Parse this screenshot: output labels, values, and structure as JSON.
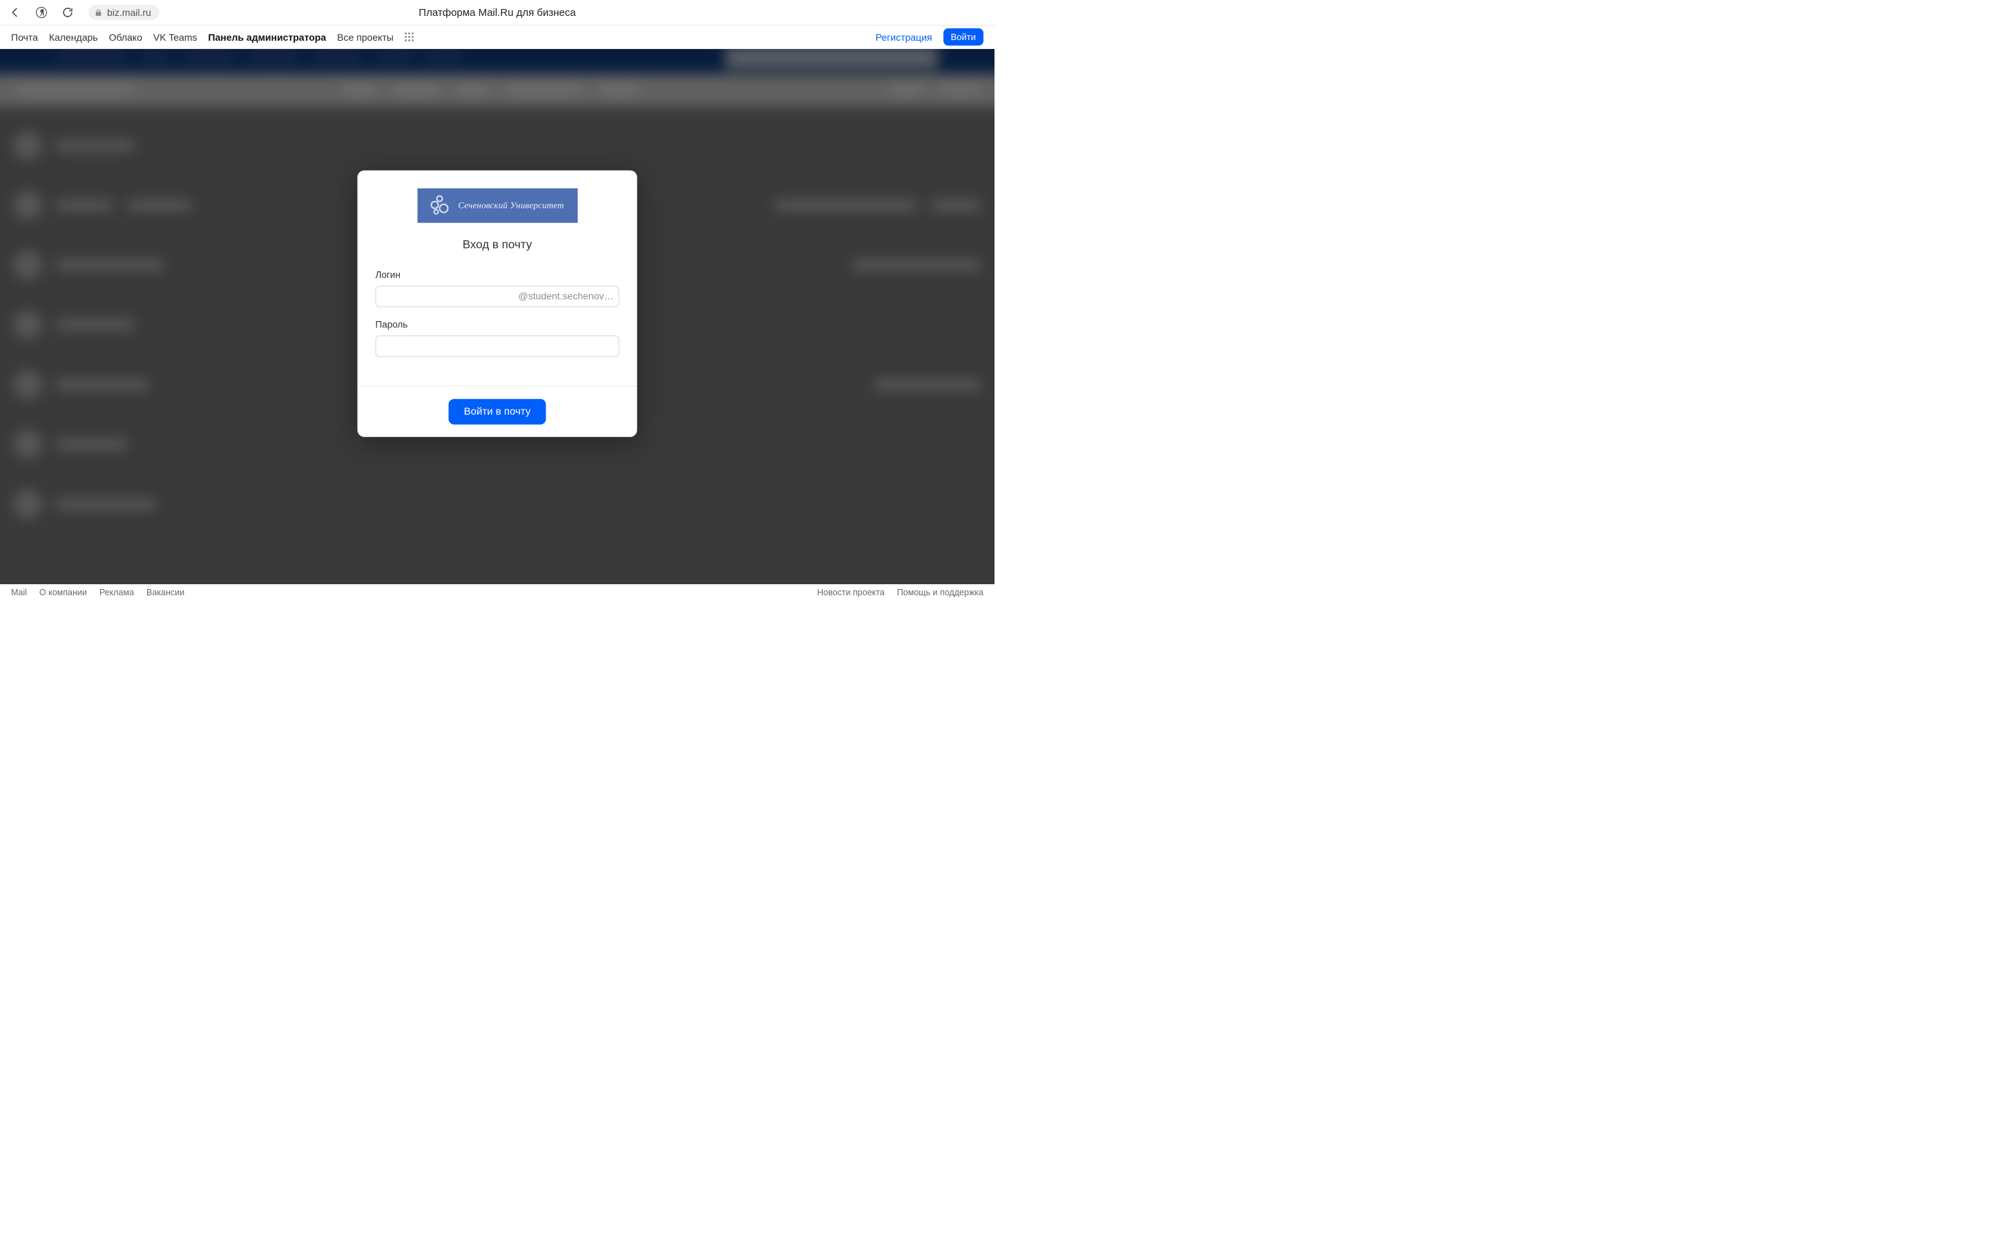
{
  "browser": {
    "page_title": "Платформа Mail.Ru для бизнеса",
    "address": "biz.mail.ru"
  },
  "services_nav": {
    "items": [
      "Почта",
      "Календарь",
      "Облако",
      "VK Teams",
      "Панель администратора",
      "Все проекты"
    ],
    "active_index": 4,
    "register_label": "Регистрация",
    "login_label": "Войти"
  },
  "login_modal": {
    "logo_text": "Сеченовский Университет",
    "title": "Вход в почту",
    "login_label": "Логин",
    "login_value": "",
    "domain_suffix": "@student.sechenov…",
    "password_label": "Пароль",
    "password_value": "",
    "submit_label": "Войти в почту"
  },
  "footer": {
    "left": [
      "Mail",
      "О компании",
      "Реклама",
      "Вакансии"
    ],
    "right": [
      "Новости проекта",
      "Помощь и поддержка"
    ]
  }
}
